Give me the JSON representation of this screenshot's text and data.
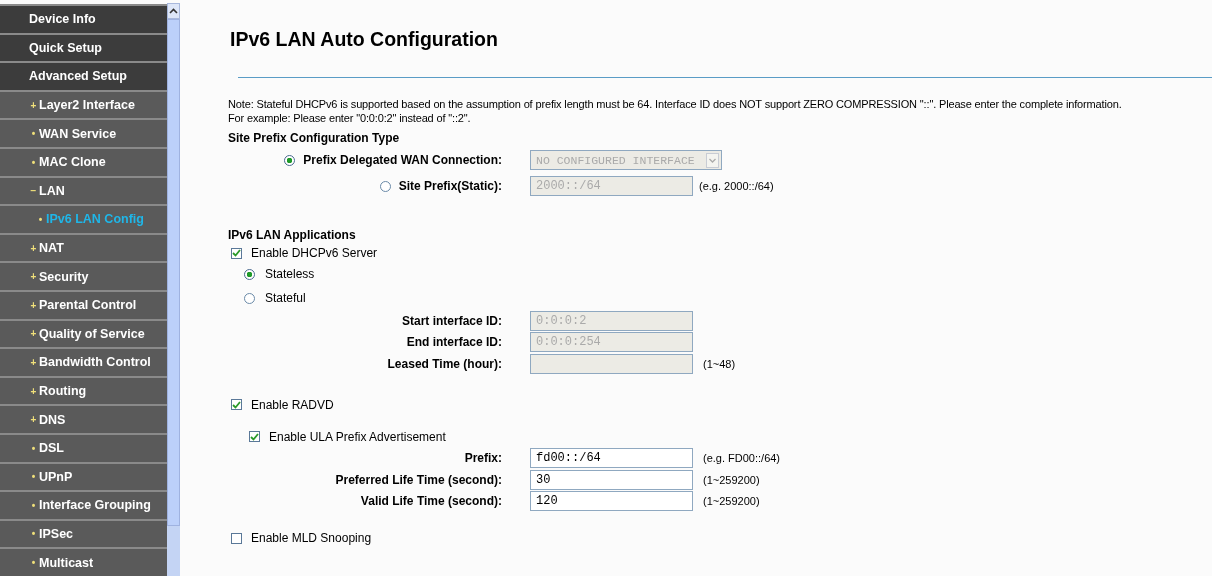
{
  "sidebar": {
    "items": [
      {
        "label": "Device Info",
        "kind": "top",
        "selected": false
      },
      {
        "label": "Quick Setup",
        "kind": "top",
        "selected": false
      },
      {
        "label": "Advanced Setup",
        "kind": "top",
        "selected": false
      },
      {
        "label": "Layer2 Interface",
        "marker": "+",
        "kind": "sub",
        "selected": false
      },
      {
        "label": "WAN Service",
        "marker": "•",
        "kind": "sub",
        "selected": false
      },
      {
        "label": "MAC Clone",
        "marker": "•",
        "kind": "sub",
        "selected": false
      },
      {
        "label": "LAN",
        "marker": "−",
        "kind": "sub",
        "selected": false,
        "children": [
          {
            "label": "IPv6 LAN Config",
            "marker": "•",
            "selected": true
          }
        ]
      },
      {
        "label": "NAT",
        "marker": "+",
        "kind": "sub",
        "selected": false
      },
      {
        "label": "Security",
        "marker": "+",
        "kind": "sub",
        "selected": false
      },
      {
        "label": "Parental Control",
        "marker": "+",
        "kind": "sub",
        "selected": false
      },
      {
        "label": "Quality of Service",
        "marker": "+",
        "kind": "sub",
        "selected": false
      },
      {
        "label": "Bandwidth Control",
        "marker": "+",
        "kind": "sub",
        "selected": false
      },
      {
        "label": "Routing",
        "marker": "+",
        "kind": "sub",
        "selected": false
      },
      {
        "label": "DNS",
        "marker": "+",
        "kind": "sub",
        "selected": false
      },
      {
        "label": "DSL",
        "marker": "•",
        "kind": "sub",
        "selected": false
      },
      {
        "label": "UPnP",
        "marker": "•",
        "kind": "sub",
        "selected": false
      },
      {
        "label": "Interface Grouping",
        "marker": "•",
        "kind": "sub",
        "selected": false
      },
      {
        "label": "IPSec",
        "marker": "•",
        "kind": "sub",
        "selected": false
      },
      {
        "label": "Multicast",
        "marker": "•",
        "kind": "sub",
        "selected": false
      }
    ]
  },
  "page": {
    "title": "IPv6 LAN Auto Configuration",
    "note": [
      "Note: Stateful DHCPv6 is supported based on the assumption of prefix length must be 64. Interface ID does NOT support ZERO COMPRESSION \"::\". Please enter the complete information.",
      "For example: Please enter \"0:0:0:2\" instead of \"::2\"."
    ],
    "site_prefix": {
      "heading": "Site Prefix Configuration Type",
      "options": [
        {
          "label": "Prefix Delegated WAN Connection:",
          "selected": true,
          "field": {
            "kind": "select",
            "value": "NO CONFIGURED INTERFACE",
            "disabled": true
          }
        },
        {
          "label": "Site Prefix(Static):",
          "selected": false,
          "field": {
            "kind": "input",
            "value": "2000::/64",
            "disabled": true
          },
          "hint": "(e.g. 2000::/64)"
        }
      ]
    },
    "applications": {
      "heading": "IPv6 LAN Applications",
      "dhcp": {
        "label": "Enable DHCPv6 Server",
        "checked": true
      },
      "modes": [
        {
          "label": "Stateless",
          "selected": true
        },
        {
          "label": "Stateful",
          "selected": false
        }
      ],
      "fields": [
        {
          "label": "Start interface ID:",
          "value": "0:0:0:2",
          "disabled": true
        },
        {
          "label": "End interface ID:",
          "value": "0:0:0:254",
          "disabled": true
        },
        {
          "label": "Leased Time (hour):",
          "disabled": true,
          "hint": "(1~48)"
        }
      ],
      "radvd": {
        "label": "Enable RADVD",
        "checked": true
      },
      "ula": {
        "label": "Enable ULA Prefix Advertisement",
        "checked": true
      },
      "ula_fields": [
        {
          "label": "Prefix:",
          "value": "fd00::/64",
          "disabled": false,
          "hint": "(e.g. FD00::/64)"
        },
        {
          "label": "Preferred Life Time (second):",
          "value": "30",
          "disabled": false,
          "hint": "(1~259200)"
        },
        {
          "label": "Valid Life Time (second):",
          "value": "120",
          "disabled": false,
          "hint": "(1~259200)"
        }
      ],
      "mld": {
        "label": "Enable MLD Snooping",
        "checked": false
      }
    }
  }
}
